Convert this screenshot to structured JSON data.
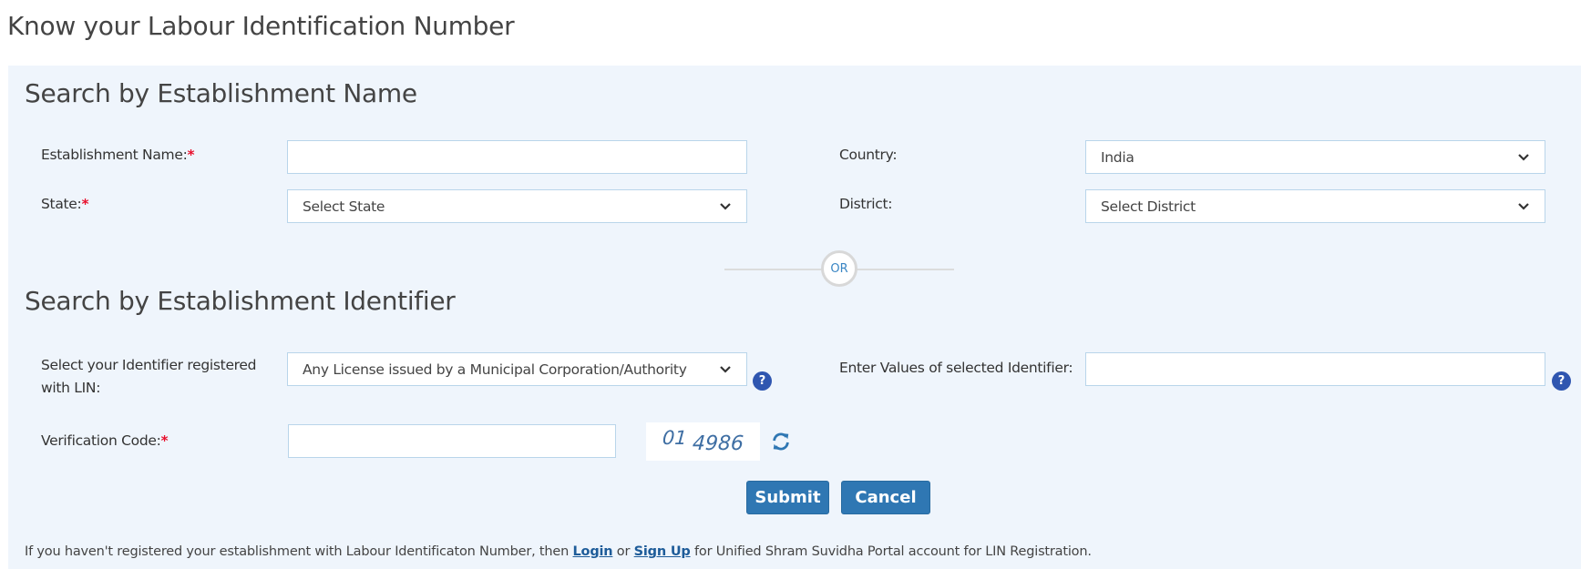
{
  "page": {
    "title": "Know your Labour Identification Number"
  },
  "section_name": {
    "title": "Search by Establishment Name",
    "establishment_name": {
      "label": "Establishment Name:",
      "required": "*",
      "value": "",
      "placeholder": ""
    },
    "country": {
      "label": "Country:",
      "selected": "India"
    },
    "state": {
      "label": "State:",
      "required": "*",
      "selected": "Select State"
    },
    "district": {
      "label": "District:",
      "selected": "Select District"
    }
  },
  "divider": {
    "label": "OR"
  },
  "section_identifier": {
    "title": "Search by Establishment Identifier",
    "identifier_type": {
      "label_line1": "Select your Identifier registered",
      "label_line2": "with LIN:",
      "selected": "Any License issued by a Municipal Corporation/Authority",
      "help_icon": "question-circle-icon"
    },
    "identifier_value": {
      "label": "Enter Values of selected Identifier:",
      "value": "",
      "help_icon": "question-circle-icon"
    },
    "verification": {
      "label": "Verification Code:",
      "required": "*",
      "value": "",
      "captcha_part1": "01",
      "captcha_part2": "4986",
      "refresh_icon": "refresh-icon"
    }
  },
  "buttons": {
    "submit": "Submit",
    "cancel": "Cancel"
  },
  "footer": {
    "text_before": "If you haven't registered your establishment with Labour Identificaton Number, then ",
    "login_link": "Login",
    "text_or": " or ",
    "signup_link": "Sign Up",
    "text_after": " for Unified Shram Suvidha Portal account for LIN Registration."
  },
  "colors": {
    "panel_bg": "#eff5fc",
    "primary_button": "#2f77b3",
    "required": "#e8102d",
    "help_icon": "#2f56b0",
    "link": "#1e5c99"
  }
}
